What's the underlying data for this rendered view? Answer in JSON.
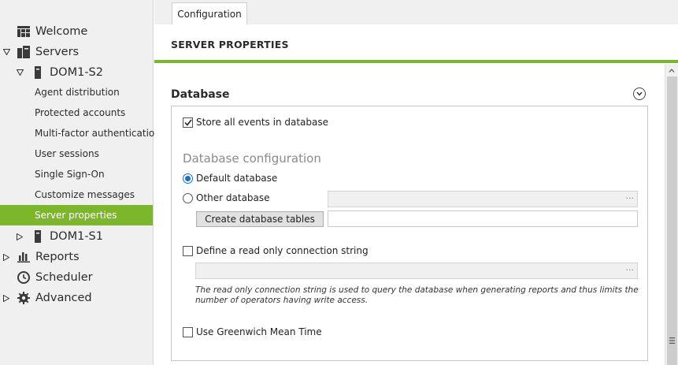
{
  "sidebar": {
    "items": [
      {
        "label": "Welcome"
      },
      {
        "label": "Servers"
      },
      {
        "label": "DOM1-S2"
      },
      {
        "label": "Agent distribution"
      },
      {
        "label": "Protected accounts"
      },
      {
        "label": "Multi-factor authentication"
      },
      {
        "label": "User sessions"
      },
      {
        "label": "Single Sign-On"
      },
      {
        "label": "Customize messages"
      },
      {
        "label": "Server properties"
      },
      {
        "label": "DOM1-S1"
      },
      {
        "label": "Reports"
      },
      {
        "label": "Scheduler"
      },
      {
        "label": "Advanced"
      }
    ],
    "active_item": "Server properties",
    "accent_color": "#7cb72b"
  },
  "tabs": [
    {
      "label": "Configuration"
    }
  ],
  "page": {
    "title": "SERVER PROPERTIES"
  },
  "database": {
    "section_title": "Database",
    "store_events": {
      "label": "Store all events in database",
      "checked": true
    },
    "config_title": "Database configuration",
    "default_db": {
      "label": "Default database",
      "selected": true
    },
    "other_db": {
      "label": "Other database",
      "selected": false,
      "value": "",
      "ellipsis": "···"
    },
    "create_tables_label": "Create database tables",
    "create_tables_value": "",
    "readonly": {
      "label": "Define a read only connection string",
      "checked": false,
      "value": "",
      "ellipsis": "···"
    },
    "note": "The read only connection string is used to query the database when generating reports and thus limits the number of operators having write access.",
    "gmt": {
      "label": "Use Greenwich Mean Time",
      "checked": false
    }
  }
}
